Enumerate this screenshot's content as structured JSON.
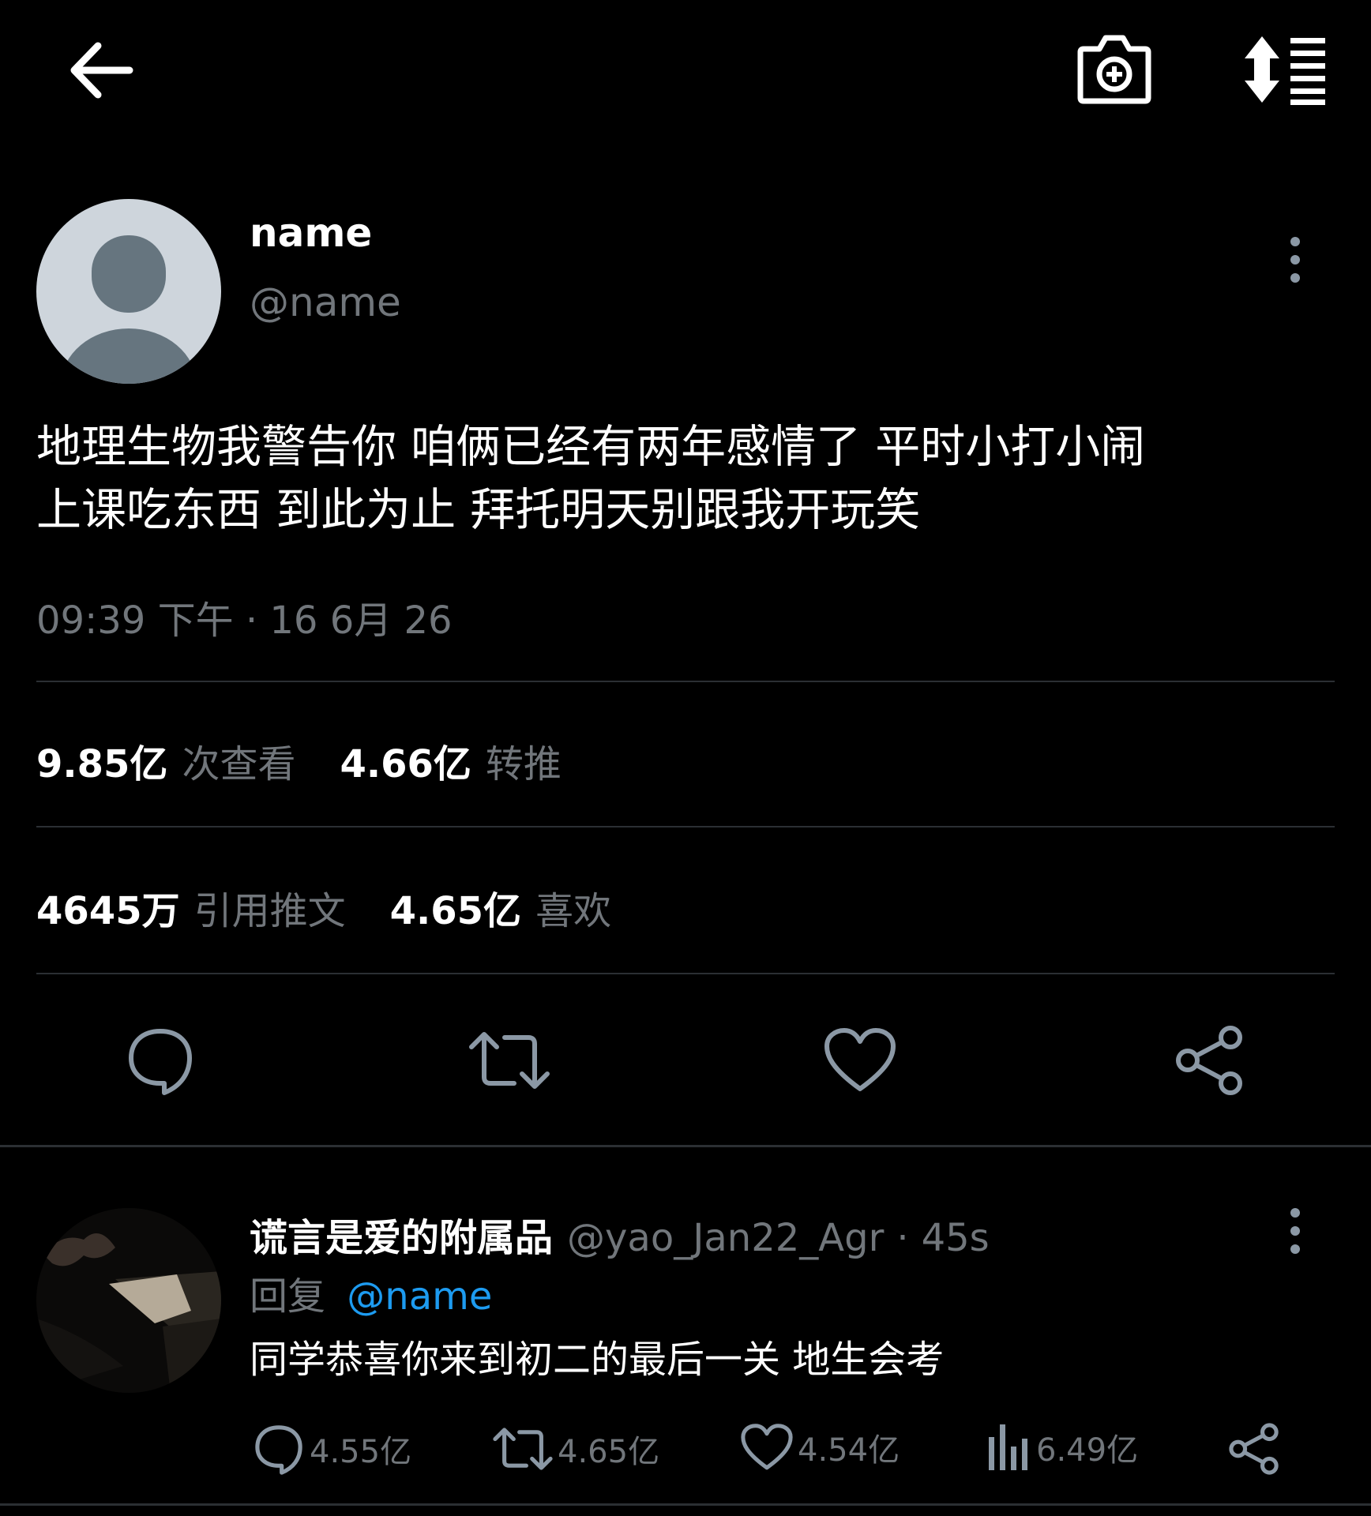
{
  "header": {
    "back_icon": "arrow-left-icon",
    "camera_icon": "camera-add-icon",
    "sort_icon": "sort-list-icon"
  },
  "tweet": {
    "display_name": "name",
    "handle": "@name",
    "text_line1": "地理生物我警告你 咱俩已经有两年感情了 平时小打小闹",
    "text_line2": "上课吃东西 到此为止 拜托明天别跟我开玩笑",
    "timestamp": "09:39 下午 · 16 6月 26",
    "stats": {
      "views_count": "9.85亿",
      "views_label": "次查看",
      "retweets_count": "4.66亿",
      "retweets_label": "转推",
      "quotes_count": "4645万",
      "quotes_label": "引用推文",
      "likes_count": "4.65亿",
      "likes_label": "喜欢"
    }
  },
  "reply": {
    "display_name": "谎言是爱的附属品",
    "handle": "@yao_Jan22_Agr",
    "separator": "·",
    "time": "45s",
    "reply_prefix": "回复",
    "reply_to": "@name",
    "text": "同学恭喜你来到初二的最后一关 地生会考",
    "counts": {
      "replies": "4.55亿",
      "retweets": "4.65亿",
      "likes": "4.54亿",
      "views": "6.49亿"
    }
  },
  "colors": {
    "background": "#000000",
    "muted": "#71767b",
    "link": "#1d9bf0",
    "divider": "#2b2f33"
  }
}
